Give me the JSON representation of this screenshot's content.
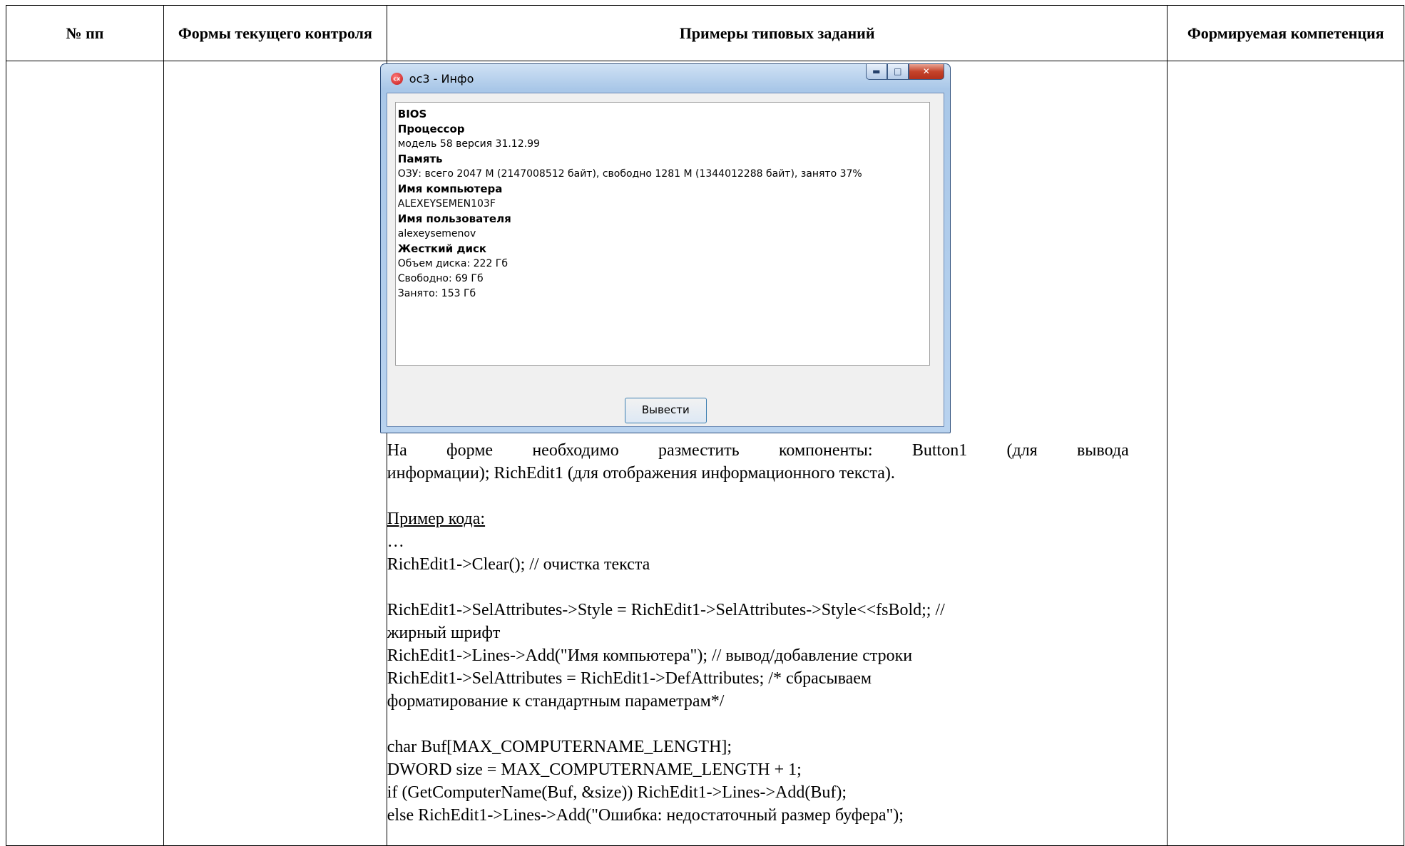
{
  "table": {
    "headers": [
      "№ пп",
      "Формы текущего контроля",
      "Примеры типовых заданий",
      "Формируемая компетенция"
    ]
  },
  "window": {
    "title": "ос3 - Инфо",
    "app_icon": "cx-icon",
    "controls": {
      "min": "minimize-icon",
      "max": "maximize-icon",
      "close": "close-icon"
    },
    "lines": [
      {
        "text": "BIOS",
        "bold": true
      },
      {
        "text": "Процессор",
        "bold": true
      },
      {
        "text": "модель 58 версия 31.12.99",
        "bold": false
      },
      {
        "text": "Память",
        "bold": true
      },
      {
        "text": "ОЗУ: всего 2047 М (2147008512 байт), свободно 1281 М (1344012288 байт), занято 37%",
        "bold": false
      },
      {
        "text": "Имя компьютера",
        "bold": true
      },
      {
        "text": "ALEXEYSEMEN103F",
        "bold": false
      },
      {
        "text": "Имя пользователя",
        "bold": true
      },
      {
        "text": "alexeysemenov",
        "bold": false
      },
      {
        "text": "Жесткий диск",
        "bold": true
      },
      {
        "text": "Объем диска: 222 Гб",
        "bold": false
      },
      {
        "text": "Свободно: 69 Гб",
        "bold": false
      },
      {
        "text": "Занято: 153 Гб",
        "bold": false
      }
    ],
    "button_label": "Вывести"
  },
  "content": {
    "para_line1": "На форме необходимо разместить компоненты: Button1 (для вывода",
    "para_line2": "информации); RichEdit1 (для отображения информационного текста).",
    "example_label": "Пример кода:",
    "ellipsis": "…",
    "code_lines": [
      "RichEdit1->Clear();   // очистка текста",
      "",
      "RichEdit1->SelAttributes->Style = RichEdit1->SelAttributes->Style<<fsBold;;  //",
      "жирный шрифт",
      "RichEdit1->Lines->Add(\"Имя компьютера\");  // вывод/добавление строки",
      "RichEdit1->SelAttributes = RichEdit1->DefAttributes;  /* сбрасываем",
      "форматирование к стандартным параметрам*/",
      "",
      "char Buf[MAX_COMPUTERNAME_LENGTH];",
      "DWORD size = MAX_COMPUTERNAME_LENGTH + 1;",
      "if (GetComputerName(Buf, &size)) RichEdit1->Lines->Add(Buf);",
      "else RichEdit1->Lines->Add(\"Ошибка: недостаточный размер буфера\");"
    ]
  }
}
